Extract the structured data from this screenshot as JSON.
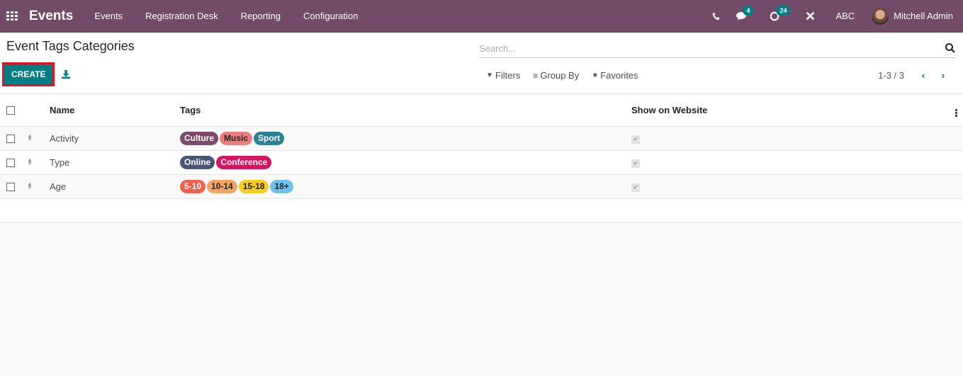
{
  "navbar": {
    "app_name": "Events",
    "menu": [
      "Events",
      "Registration Desk",
      "Reporting",
      "Configuration"
    ],
    "messages_badge": "4",
    "activities_badge": "24",
    "company": "ABC",
    "user_name": "Mitchell Admin",
    "brand_color": "#714B67"
  },
  "control_panel": {
    "title": "Event Tags Categories",
    "create_label": "CREATE",
    "search_placeholder": "Search...",
    "filters_label": "Filters",
    "group_by_label": "Group By",
    "favorites_label": "Favorites",
    "pager_value": "1-3 / 3",
    "accent_color": "#017e84"
  },
  "table": {
    "columns": [
      "Name",
      "Tags",
      "Show on Website"
    ],
    "rows": [
      {
        "name": "Activity",
        "tags": [
          {
            "label": "Culture",
            "bg": "#7b4a68",
            "fg": "#ffffff"
          },
          {
            "label": "Music",
            "bg": "#ea7d7e",
            "fg": "#212529"
          },
          {
            "label": "Sport",
            "bg": "#2a8294",
            "fg": "#ffffff"
          }
        ],
        "show_on_website": true
      },
      {
        "name": "Type",
        "tags": [
          {
            "label": "Online",
            "bg": "#475577",
            "fg": "#ffffff"
          },
          {
            "label": "Conference",
            "bg": "#d6145f",
            "fg": "#ffffff"
          }
        ],
        "show_on_website": true
      },
      {
        "name": "Age",
        "tags": [
          {
            "label": "5-10",
            "bg": "#f06050",
            "fg": "#ffffff"
          },
          {
            "label": "10-14",
            "bg": "#f4a460",
            "fg": "#212529"
          },
          {
            "label": "15-18",
            "bg": "#f7cd1f",
            "fg": "#212529"
          },
          {
            "label": "18+",
            "bg": "#6cc1ed",
            "fg": "#212529"
          }
        ],
        "show_on_website": true
      }
    ]
  }
}
